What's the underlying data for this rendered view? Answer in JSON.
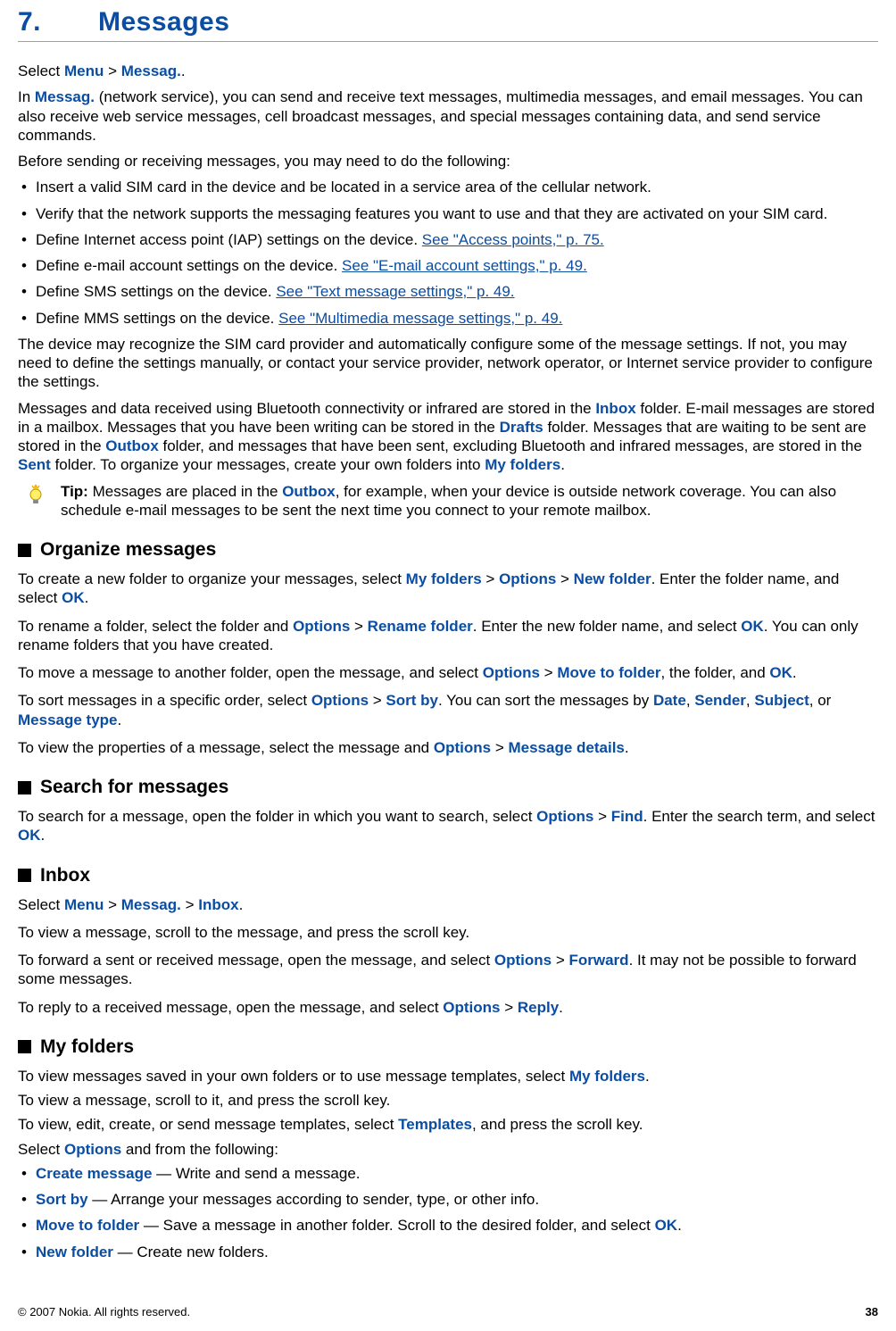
{
  "chapter": {
    "number": "7.",
    "title": "Messages"
  },
  "intro": {
    "selectPrefix": "Select ",
    "menu": "Menu",
    "gt": " > ",
    "messag": "Messag.",
    "period": ".",
    "p2_a": "In ",
    "p2_b": " (network service), you can send and receive text messages, multimedia messages, and email messages. You can also receive web service messages, cell broadcast messages, and special messages containing data, and send service commands.",
    "p3": "Before sending or receiving messages, you may need to do the following:",
    "bul1": "Insert a valid SIM card in the device and be located in a service area of the cellular network.",
    "bul2": "Verify that the network supports the messaging features you want to use and that they are activated on your SIM card.",
    "bul3_a": "Define Internet access point (IAP) settings on the device. ",
    "bul3_link": "See \"Access points,\" p. 75.",
    "bul4_a": "Define e-mail account settings on the device. ",
    "bul4_link": "See \"E-mail account settings,\" p. 49.",
    "bul5_a": "Define SMS settings on the device. ",
    "bul5_link": "See \"Text message settings,\" p. 49.",
    "bul6_a": "Define MMS settings on the device. ",
    "bul6_link": "See \"Multimedia message settings,\" p. 49.",
    "p4": "The device may recognize the SIM card provider and automatically configure some of the message settings. If not, you may need to define the settings manually, or contact your service provider, network operator, or Internet service provider to configure the settings.",
    "p5_a": "Messages and data received using Bluetooth connectivity or infrared are stored in the ",
    "inbox": "Inbox",
    "p5_b": " folder. E-mail messages are stored in a mailbox. Messages that you have been writing can be stored in the ",
    "drafts": "Drafts",
    "p5_c": " folder. Messages that are waiting to be sent are stored in the ",
    "outbox": "Outbox",
    "p5_d": " folder, and messages that have been sent, excluding Bluetooth and infrared messages, are stored in the ",
    "sent": "Sent",
    "p5_e": " folder. To organize your messages, create your own folders into ",
    "myfolders": "My folders",
    "tip_label": "Tip: ",
    "tip_a": "Messages are placed in the ",
    "tip_b": ", for example, when your device is outside network coverage. You can also schedule e-mail messages to be sent the next time you connect to your remote mailbox."
  },
  "organize": {
    "title": "Organize messages",
    "p1_a": "To create a new folder to organize your messages, select ",
    "p1_b": ". Enter the folder name, and select ",
    "options": "Options",
    "newfolder": "New folder",
    "ok": "OK",
    "p2_a": "To rename a folder, select the folder and ",
    "rename": "Rename folder",
    "p2_b": ". Enter the new folder name, and select ",
    "p2_c": ". You can only rename folders that you have created.",
    "p3_a": "To move a message to another folder, open the message, and select ",
    "movetofolder": "Move to folder",
    "p3_b": ", the folder, and ",
    "p4_a": "To sort messages in a specific order, select ",
    "sortby": "Sort by",
    "p4_b": ". You can sort the messages by ",
    "date": "Date",
    "sender": "Sender",
    "subject": "Subject",
    "messagetype": "Message type",
    "comma": ", ",
    "or": ", or ",
    "p5_a": "To view the properties of a message, select the message and ",
    "msgdetails": "Message details"
  },
  "search": {
    "title": "Search for messages",
    "p1_a": "To search for a message, open the folder in which you want to search, select ",
    "find": "Find",
    "p1_b": ". Enter the search term, and select "
  },
  "inboxSec": {
    "title": "Inbox",
    "p1_a": "Select ",
    "p2": "To view a message, scroll to the message, and press the scroll key.",
    "p3_a": "To forward a sent or received message, open the message, and select ",
    "forward": "Forward",
    "p3_b": ". It may not be possible to forward some messages.",
    "p4_a": "To reply to a received message, open the message, and select ",
    "reply": "Reply"
  },
  "myfoldersSec": {
    "title": "My folders",
    "p1_a": "To view messages saved in your own folders or to use message templates, select ",
    "p2": "To view a message, scroll to it, and press the scroll key.",
    "p3_a": "To view, edit, create, or send message templates, select ",
    "templates": "Templates",
    "p3_b": ", and press the scroll key.",
    "p4_a": "Select ",
    "p4_b": " and from the following:",
    "opt1_name": "Create message",
    "opt1_desc": " — Write and send a message.",
    "opt2_name": "Sort by",
    "opt2_desc": " — Arrange your messages according to sender, type, or other info.",
    "opt3_name": "Move to folder",
    "opt3_desc": " — Save a message in another folder. Scroll to the desired folder, and select ",
    "opt4_name": "New folder",
    "opt4_desc": " — Create new folders."
  },
  "footer": {
    "copyright": "© 2007 Nokia. All rights reserved.",
    "page": "38"
  }
}
